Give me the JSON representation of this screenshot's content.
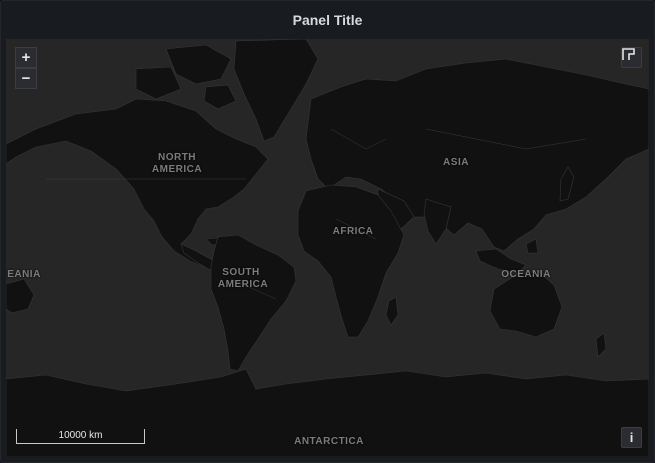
{
  "panel": {
    "title": "Panel Title"
  },
  "controls": {
    "zoom_in": "+",
    "zoom_out": "−",
    "info": "i"
  },
  "scale": {
    "text": "10000 km"
  },
  "labels": {
    "north_america_1": "NORTH",
    "north_america_2": "AMERICA",
    "south_america_1": "SOUTH",
    "south_america_2": "AMERICA",
    "africa": "AFRICA",
    "asia": "ASIA",
    "oceania_right": "OCEANIA",
    "oceania_left": "EANIA",
    "antarctica": "ANTARCTICA"
  },
  "colors": {
    "land": "#111111",
    "water": "#262626",
    "border": "#3a3a3a"
  }
}
